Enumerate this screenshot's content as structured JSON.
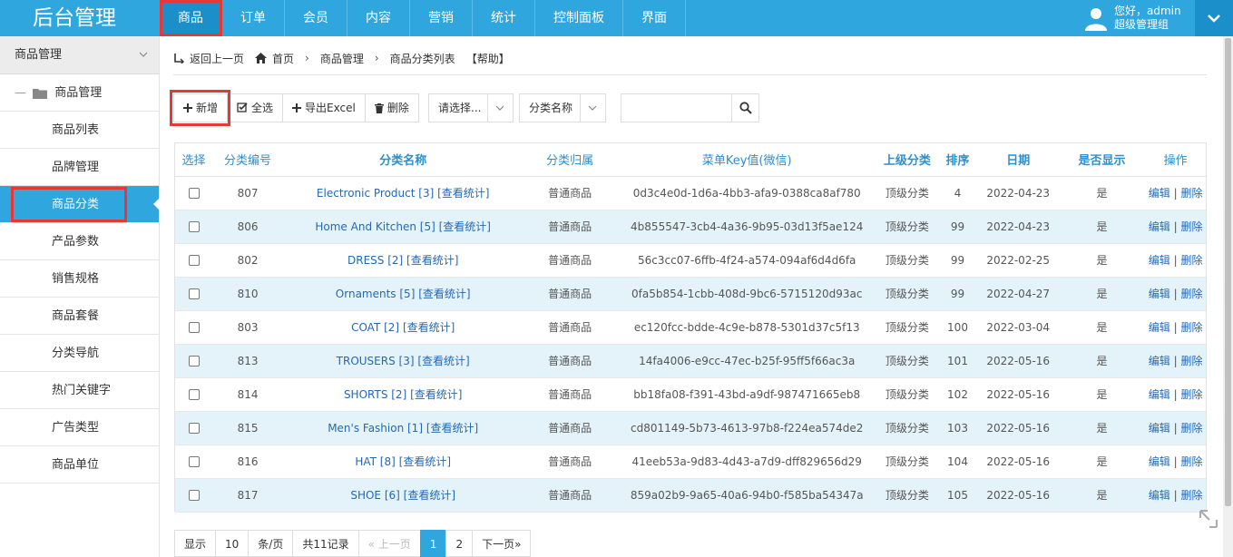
{
  "brand": "后台管理",
  "topnav": [
    "商品",
    "订单",
    "会员",
    "内容",
    "营销",
    "统计",
    "控制面板",
    "界面"
  ],
  "user": {
    "greeting": "您好，admin",
    "role": "超级管理组"
  },
  "sidebar": {
    "header": "商品管理",
    "group": "商品管理",
    "items": [
      "商品列表",
      "品牌管理",
      "商品分类",
      "产品参数",
      "销售规格",
      "商品套餐",
      "分类导航",
      "热门关键字",
      "广告类型",
      "商品单位"
    ]
  },
  "breadcrumb": {
    "back": "返回上一页",
    "home": "首页",
    "level1": "商品管理",
    "level2": "商品分类列表",
    "help": "【帮助】"
  },
  "toolbar": {
    "add": "新增",
    "select_all": "全选",
    "export": "导出Excel",
    "delete": "删除"
  },
  "filters": {
    "select1": "请选择...",
    "select2": "分类名称",
    "search_placeholder": ""
  },
  "table": {
    "headers": [
      "选择",
      "分类编号",
      "分类名称",
      "分类归属",
      "菜单Key值(微信)",
      "上级分类",
      "排序",
      "日期",
      "是否显示",
      "操作"
    ],
    "stats_link": "[查看统计]",
    "edit": "编辑",
    "del": "删除",
    "rows": [
      {
        "id": "807",
        "name": "Electronic Product [3]",
        "owner": "普通商品",
        "key": "0d3c4e0d-1d6a-4bb3-afa9-0388ca8af780",
        "parent": "顶级分类",
        "sort": "4",
        "date": "2022-04-23",
        "show": "是"
      },
      {
        "id": "806",
        "name": "Home And Kitchen [5]",
        "owner": "普通商品",
        "key": "4b855547-3cb4-4a36-9b95-03d13f5ae124",
        "parent": "顶级分类",
        "sort": "99",
        "date": "2022-04-23",
        "show": "是"
      },
      {
        "id": "802",
        "name": "DRESS [2]",
        "owner": "普通商品",
        "key": "56c3cc07-6ffb-4f24-a574-094af6d4d6fa",
        "parent": "顶级分类",
        "sort": "99",
        "date": "2022-02-25",
        "show": "是"
      },
      {
        "id": "810",
        "name": "Ornaments [5]",
        "owner": "普通商品",
        "key": "0fa5b854-1cbb-408d-9bc6-5715120d93ac",
        "parent": "顶级分类",
        "sort": "99",
        "date": "2022-04-27",
        "show": "是"
      },
      {
        "id": "803",
        "name": "COAT [2]",
        "owner": "普通商品",
        "key": "ec120fcc-bdde-4c9e-b878-5301d37c5f13",
        "parent": "顶级分类",
        "sort": "100",
        "date": "2022-03-04",
        "show": "是"
      },
      {
        "id": "813",
        "name": "TROUSERS [3]",
        "owner": "普通商品",
        "key": "14fa4006-e9cc-47ec-b25f-95ff5f66ac3a",
        "parent": "顶级分类",
        "sort": "101",
        "date": "2022-05-16",
        "show": "是"
      },
      {
        "id": "814",
        "name": "SHORTS [2]",
        "owner": "普通商品",
        "key": "bb18fa08-f391-43bd-a9df-987471665eb8",
        "parent": "顶级分类",
        "sort": "102",
        "date": "2022-05-16",
        "show": "是"
      },
      {
        "id": "815",
        "name": "Men's Fashion [1]",
        "owner": "普通商品",
        "key": "cd801149-5b73-4613-97b8-f224ea574de2",
        "parent": "顶级分类",
        "sort": "103",
        "date": "2022-05-16",
        "show": "是"
      },
      {
        "id": "816",
        "name": "HAT [8]",
        "owner": "普通商品",
        "key": "41eeb53a-9d83-4d43-a7d9-dff829656d29",
        "parent": "顶级分类",
        "sort": "104",
        "date": "2022-05-16",
        "show": "是"
      },
      {
        "id": "817",
        "name": "SHOE [6]",
        "owner": "普通商品",
        "key": "859a02b9-9a65-40a6-94b0-f585ba54347a",
        "parent": "顶级分类",
        "sort": "105",
        "date": "2022-05-16",
        "show": "是"
      }
    ]
  },
  "pager": {
    "show": "显示",
    "per": "10",
    "unit": "条/页",
    "total": "共11记录",
    "prev": "« 上一页",
    "p1": "1",
    "p2": "2",
    "next": "下一页»"
  },
  "colors": {
    "primary": "#2fa6dd",
    "dark": "#1a8fc9",
    "highlight": "#e53935",
    "link": "#2468b5",
    "alt_row": "#e4f3fa"
  }
}
